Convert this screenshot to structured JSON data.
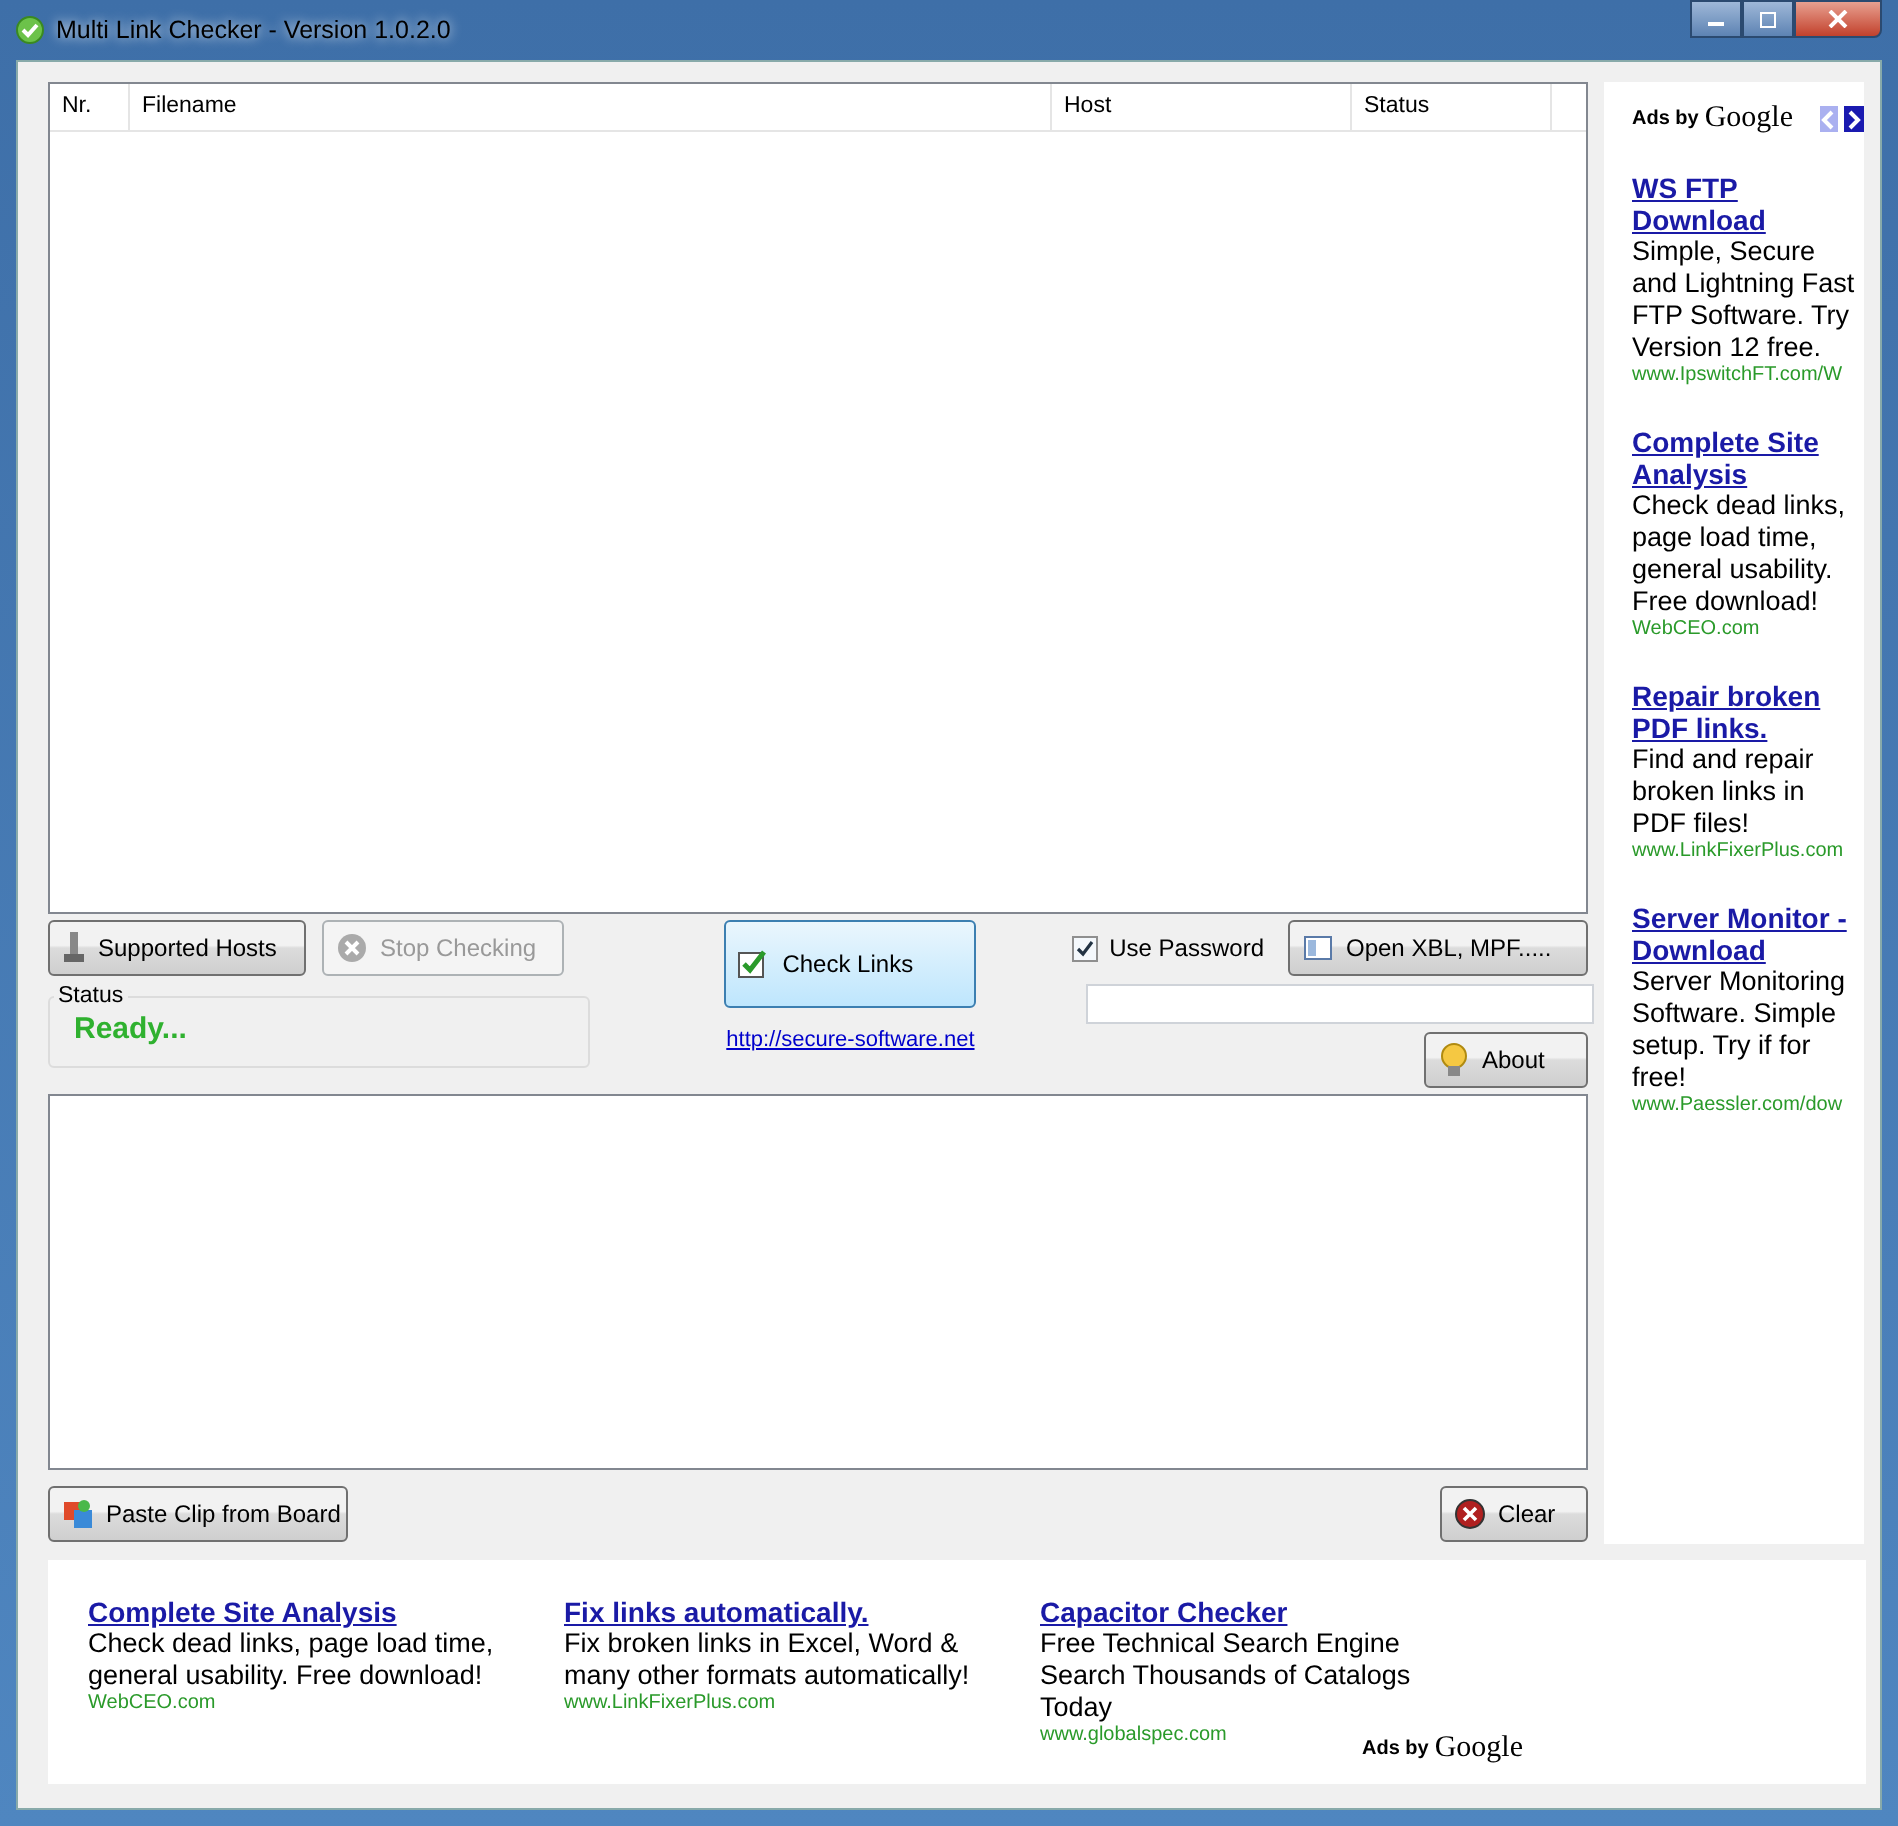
{
  "window": {
    "title": "Multi Link Checker - Version 1.0.2.0"
  },
  "table": {
    "columns": [
      "Nr.",
      "Filename",
      "Host",
      "Status"
    ]
  },
  "buttons": {
    "supported_hosts": {
      "label": "Supported Hosts",
      "disabled": false
    },
    "stop_checking": {
      "label": "Stop Checking",
      "disabled": true
    },
    "check_links": {
      "label": "Check Links"
    },
    "open": {
      "label": "Open XBL, MPF....."
    },
    "about": {
      "label": "About"
    },
    "paste": {
      "label": "Paste Clip from Board"
    },
    "clear": {
      "label": "Clear"
    }
  },
  "status": {
    "label": "Status",
    "value": "Ready..."
  },
  "link": "http://secure-software.net",
  "use_password": {
    "label": "Use Password",
    "checked": true
  },
  "side_ads": {
    "ads_by": "Ads by",
    "brand": "Google",
    "items": [
      {
        "title": "WS FTP Download",
        "text": "Simple, Secure and Lightning Fast FTP Software. Try Version 12 free.",
        "url": "www.IpswitchFT.com/W"
      },
      {
        "title": "Complete Site Analysis",
        "text": "Check dead links, page load time, general usability. Free download!",
        "url": "WebCEO.com"
      },
      {
        "title": "Repair broken PDF links.",
        "text": "Find and repair broken links in PDF files!",
        "url": "www.LinkFixerPlus.com"
      },
      {
        "title": "Server Monitor - Download",
        "text": "Server Monitoring Software. Simple setup. Try if for free!",
        "url": "www.Paessler.com/dow"
      }
    ]
  },
  "bottom_ads": {
    "ads_by": "Ads by",
    "brand": "Google",
    "items": [
      {
        "title": "Complete Site Analysis",
        "text": "Check dead links, page load time, general usability. Free download!",
        "url": "WebCEO.com"
      },
      {
        "title": "Fix links automatically.",
        "text": "Fix broken links in Excel, Word & many other formats automatically!",
        "url": "www.LinkFixerPlus.com"
      },
      {
        "title": "Capacitor Checker",
        "text": "Free Technical Search Engine Search Thousands of Catalogs Today",
        "url": "www.globalspec.com"
      }
    ]
  }
}
